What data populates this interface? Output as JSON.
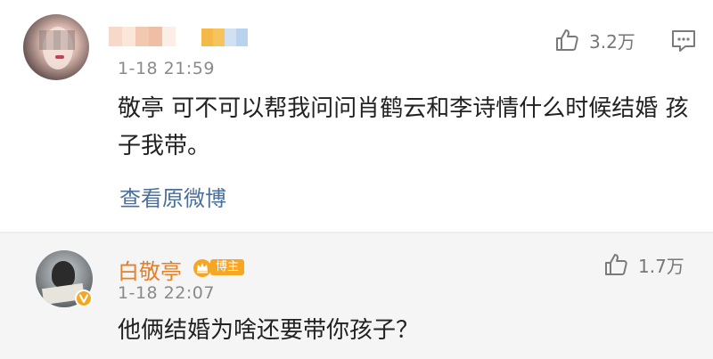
{
  "comments": [
    {
      "time": "1-18 21:59",
      "text": "敬亭 可不可以帮我问问肖鹤云和李诗情什么时候结婚 孩子我带。",
      "view_original": "查看原微博",
      "likes": "3.2万"
    }
  ],
  "reply": {
    "author": "白敬亭",
    "badge": "博主",
    "time": "1-18 22:07",
    "text": "他俩结婚为啥还要带你孩子？",
    "likes": "1.7万"
  },
  "colors": {
    "name_orange": "#e3802a",
    "link_blue": "#4a6f9c",
    "badge_orange": "#f6a623",
    "reply_bg": "#f5f5f5"
  },
  "icons": {
    "like": "thumbs-up-icon",
    "reply": "comment-icon",
    "verified": "verified-v-icon",
    "host": "crown-icon"
  }
}
